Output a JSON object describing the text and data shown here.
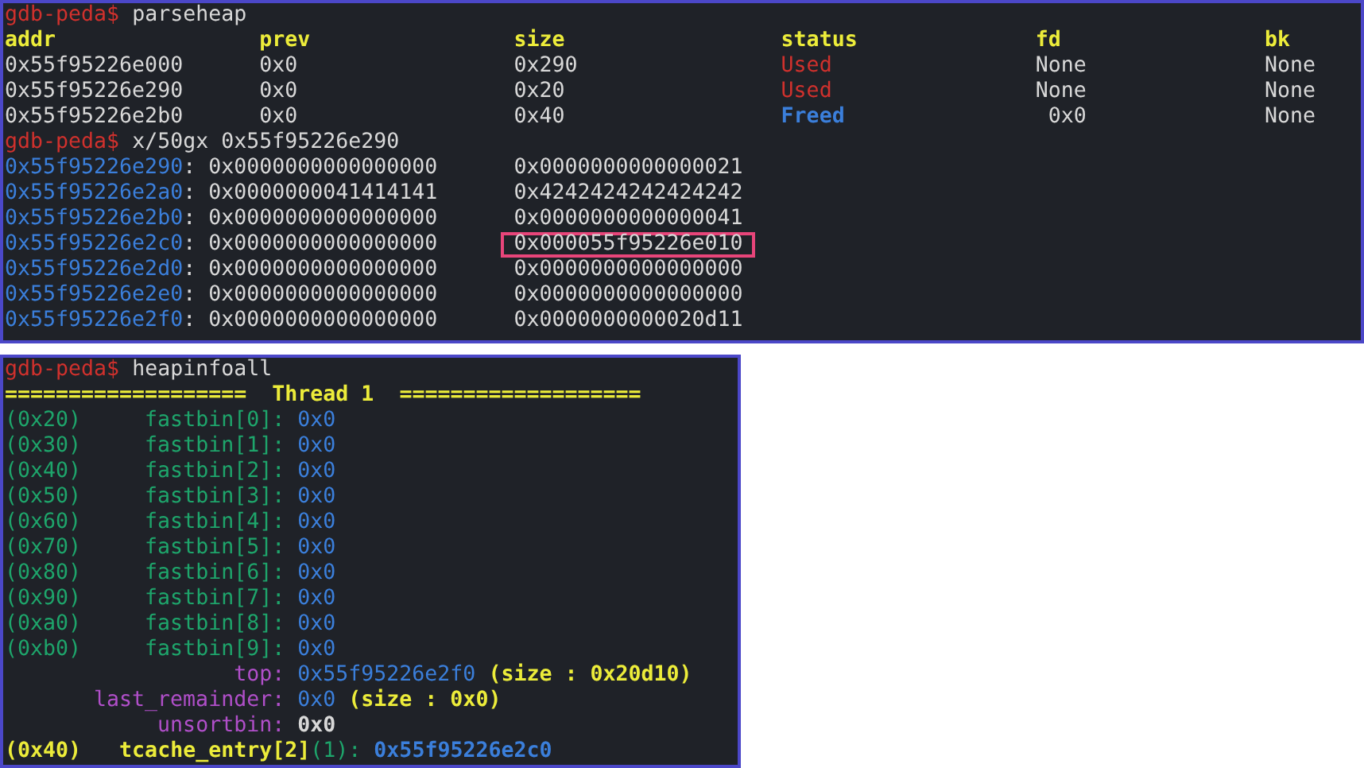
{
  "parseheap": {
    "prompt": "gdb-peda$",
    "command": "parseheap",
    "columns": [
      "addr",
      "prev",
      "size",
      "status",
      "fd",
      "bk"
    ],
    "rows": [
      {
        "addr": "0x55f95226e000",
        "prev": "0x0",
        "size": "0x290",
        "status": "Used",
        "kind": "used",
        "fd": "None",
        "bk": "None"
      },
      {
        "addr": "0x55f95226e290",
        "prev": "0x0",
        "size": "0x20",
        "status": "Used",
        "kind": "used",
        "fd": "None",
        "bk": "None"
      },
      {
        "addr": "0x55f95226e2b0",
        "prev": "0x0",
        "size": "0x40",
        "status": "Freed",
        "kind": "freed",
        "fd": "0x0",
        "bk": "None"
      }
    ]
  },
  "dump": {
    "prompt": "gdb-peda$",
    "command": "x/50gx 0x55f95226e290",
    "rows": [
      {
        "address": "0x55f95226e290",
        "separator": ":",
        "values": [
          {
            "text": "0x0000000000000000",
            "highlighted": false
          },
          {
            "text": "0x0000000000000021",
            "highlighted": false
          }
        ]
      },
      {
        "address": "0x55f95226e2a0",
        "separator": ":",
        "values": [
          {
            "text": "0x0000000041414141",
            "highlighted": false
          },
          {
            "text": "0x4242424242424242",
            "highlighted": false
          }
        ]
      },
      {
        "address": "0x55f95226e2b0",
        "separator": ":",
        "values": [
          {
            "text": "0x0000000000000000",
            "highlighted": false
          },
          {
            "text": "0x0000000000000041",
            "highlighted": false
          }
        ]
      },
      {
        "address": "0x55f95226e2c0",
        "separator": ":",
        "values": [
          {
            "text": "0x0000000000000000",
            "highlighted": false
          },
          {
            "text": "0x000055f95226e010",
            "highlighted": true
          }
        ]
      },
      {
        "address": "0x55f95226e2d0",
        "separator": ":",
        "values": [
          {
            "text": "0x0000000000000000",
            "highlighted": false
          },
          {
            "text": "0x0000000000000000",
            "highlighted": false
          }
        ]
      },
      {
        "address": "0x55f95226e2e0",
        "separator": ":",
        "values": [
          {
            "text": "0x0000000000000000",
            "highlighted": false
          },
          {
            "text": "0x0000000000000000",
            "highlighted": false
          }
        ]
      },
      {
        "address": "0x55f95226e2f0",
        "separator": ":",
        "values": [
          {
            "text": "0x0000000000000000",
            "highlighted": false
          },
          {
            "text": "0x0000000000020d11",
            "highlighted": false
          }
        ]
      }
    ]
  },
  "heapinfo": {
    "prompt": "gdb-peda$",
    "command": "heapinfoall",
    "banner": {
      "left": "===================",
      "title": "Thread 1",
      "right": "==================="
    },
    "fastbins": [
      {
        "size": "(0x20)",
        "label": "fastbin[0]:",
        "value": "0x0"
      },
      {
        "size": "(0x30)",
        "label": "fastbin[1]:",
        "value": "0x0"
      },
      {
        "size": "(0x40)",
        "label": "fastbin[2]:",
        "value": "0x0"
      },
      {
        "size": "(0x50)",
        "label": "fastbin[3]:",
        "value": "0x0"
      },
      {
        "size": "(0x60)",
        "label": "fastbin[4]:",
        "value": "0x0"
      },
      {
        "size": "(0x70)",
        "label": "fastbin[5]:",
        "value": "0x0"
      },
      {
        "size": "(0x80)",
        "label": "fastbin[6]:",
        "value": "0x0"
      },
      {
        "size": "(0x90)",
        "label": "fastbin[7]:",
        "value": "0x0"
      },
      {
        "size": "(0xa0)",
        "label": "fastbin[8]:",
        "value": "0x0"
      },
      {
        "size": "(0xb0)",
        "label": "fastbin[9]:",
        "value": "0x0"
      }
    ],
    "arena": [
      {
        "label": "top:",
        "value": "0x55f95226e2f0",
        "kind": "address",
        "note": "(size : 0x20d10)"
      },
      {
        "label": "last_remainder:",
        "value": "0x0",
        "kind": "address",
        "note": "(size : 0x0)"
      },
      {
        "label": "unsortbin:",
        "value": "0x0",
        "kind": "plain"
      }
    ],
    "tcache": [
      {
        "size": "(0x40)",
        "label": "tcache_entry[2]",
        "count": "(1):",
        "value": "0x55f95226e2c0"
      }
    ]
  }
}
